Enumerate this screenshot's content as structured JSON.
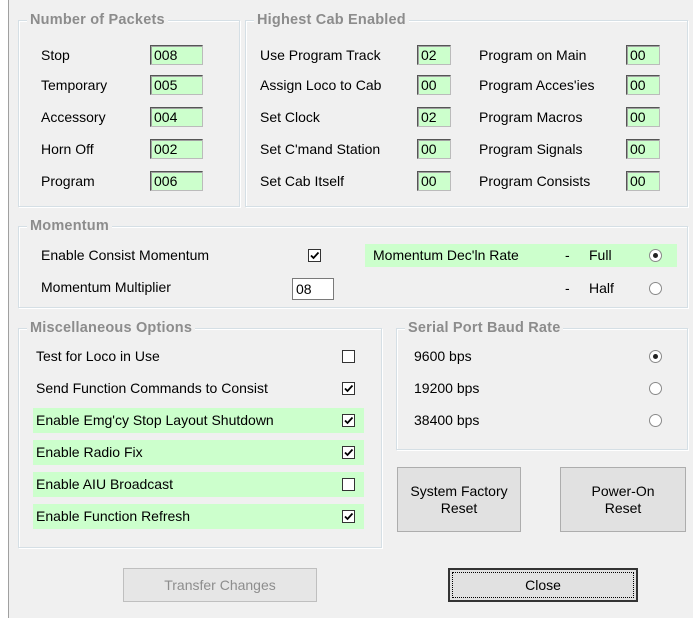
{
  "packets": {
    "title": "Number of Packets",
    "rows": [
      {
        "label": "Stop",
        "value": "008"
      },
      {
        "label": "Temporary",
        "value": "005"
      },
      {
        "label": "Accessory",
        "value": "004"
      },
      {
        "label": "Horn Off",
        "value": "002"
      },
      {
        "label": "Program",
        "value": "006"
      }
    ]
  },
  "cab": {
    "title": "Highest Cab Enabled",
    "left": [
      {
        "label": "Use Program Track",
        "value": "02"
      },
      {
        "label": "Assign Loco to Cab",
        "value": "00"
      },
      {
        "label": "Set Clock",
        "value": "02"
      },
      {
        "label": "Set C'mand Station",
        "value": "00"
      },
      {
        "label": "Set Cab Itself",
        "value": "00"
      }
    ],
    "right": [
      {
        "label": "Program on Main",
        "value": "00"
      },
      {
        "label": "Program Acces'ies",
        "value": "00"
      },
      {
        "label": "Program Macros",
        "value": "00"
      },
      {
        "label": "Program Signals",
        "value": "00"
      },
      {
        "label": "Program Consists",
        "value": "00"
      }
    ]
  },
  "momentum": {
    "title": "Momentum",
    "enable_label": "Enable Consist Momentum",
    "enable_checked": true,
    "multiplier_label": "Momentum Multiplier",
    "multiplier_value": "08",
    "rate_label": "Momentum Dec'ln Rate",
    "dash": "-",
    "full_label": "Full",
    "full_selected": true,
    "half_label": "Half",
    "half_selected": false
  },
  "misc": {
    "title": "Miscellaneous Options",
    "options": [
      {
        "label": "Test for Loco in Use",
        "checked": false,
        "highlight": false
      },
      {
        "label": "Send Function Commands to Consist",
        "checked": true,
        "highlight": false
      },
      {
        "label": "Enable Emg'cy Stop Layout Shutdown",
        "checked": true,
        "highlight": true
      },
      {
        "label": "Enable Radio Fix",
        "checked": true,
        "highlight": true
      },
      {
        "label": "Enable AIU Broadcast",
        "checked": false,
        "highlight": true
      },
      {
        "label": "Enable Function Refresh",
        "checked": true,
        "highlight": true
      }
    ]
  },
  "baud": {
    "title": "Serial Port Baud Rate",
    "options": [
      {
        "label": "9600 bps",
        "selected": true
      },
      {
        "label": "19200 bps",
        "selected": false
      },
      {
        "label": "38400 bps",
        "selected": false
      }
    ]
  },
  "buttons": {
    "factory_reset": "System Factory\nReset",
    "poweron_reset": "Power-On\nReset",
    "transfer": "Transfer Changes",
    "close": "Close"
  },
  "colors": {
    "highlight": "#ccffcc",
    "group_title": "#8c8c8c",
    "dialog_bg": "#f0f0f0"
  }
}
